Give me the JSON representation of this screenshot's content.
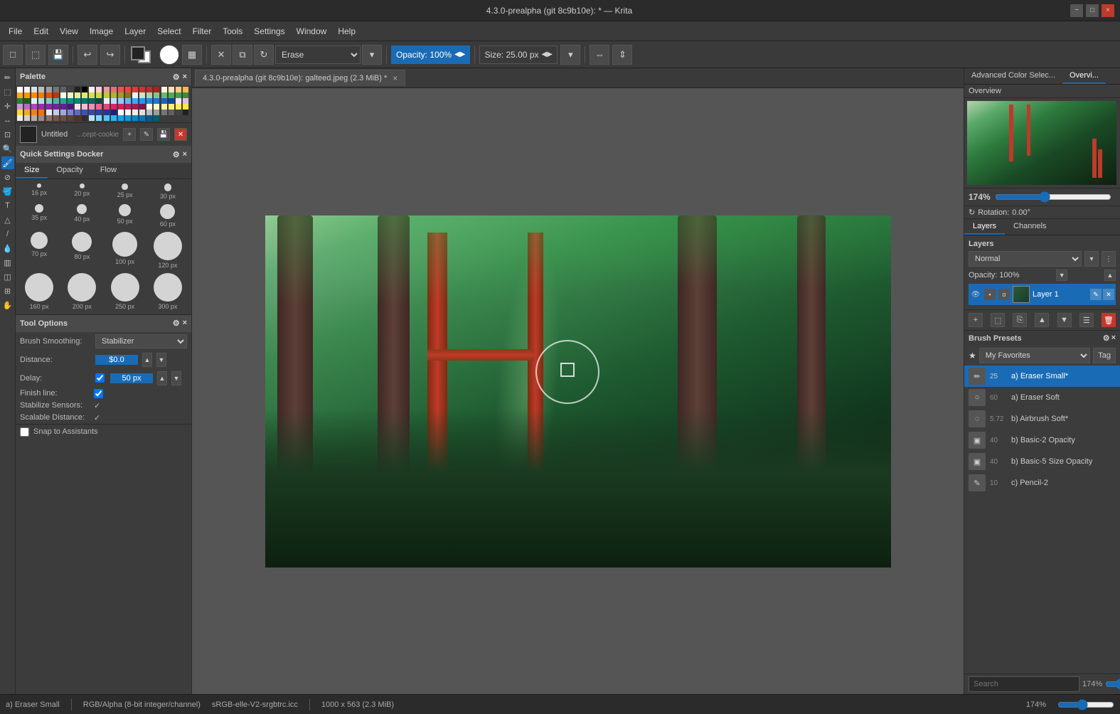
{
  "titlebar": {
    "title": "4.3.0-prealpha (git 8c9b10e): * — Krita",
    "minimize": "−",
    "maximize": "□",
    "close": "×"
  },
  "menubar": {
    "items": [
      "File",
      "Edit",
      "View",
      "Image",
      "Layer",
      "Select",
      "Filter",
      "Tools",
      "Settings",
      "Window",
      "Help"
    ]
  },
  "toolbar": {
    "erase_mode": "Erase",
    "opacity_label": "Opacity: 100%",
    "size_label": "Size: 25.00 px"
  },
  "left_dock": {
    "palette_title": "Palette",
    "color_name": "Untitled",
    "brush_source": "...cept-cookie",
    "quick_settings_title": "Quick Settings Docker",
    "tabs": [
      "Size",
      "Opacity",
      "Flow"
    ],
    "active_tab": "Size",
    "brush_sizes": [
      {
        "size": 16,
        "label": "16 px"
      },
      {
        "size": 20,
        "label": "20 px"
      },
      {
        "size": 25,
        "label": "25 px"
      },
      {
        "size": 30,
        "label": "30 px"
      },
      {
        "size": 35,
        "label": "35 px"
      },
      {
        "size": 40,
        "label": "40 px"
      },
      {
        "size": 50,
        "label": "50 px"
      },
      {
        "size": 60,
        "label": "60 px"
      },
      {
        "size": 70,
        "label": "70 px"
      },
      {
        "size": 80,
        "label": "80 px"
      },
      {
        "size": 100,
        "label": "100 px"
      },
      {
        "size": 120,
        "label": "120 px"
      },
      {
        "size": 160,
        "label": "160 px"
      },
      {
        "size": 200,
        "label": "200 px"
      },
      {
        "size": 250,
        "label": "250 px"
      },
      {
        "size": 300,
        "label": "300 px"
      }
    ],
    "tool_options_title": "Tool Options",
    "brush_smoothing_label": "Brush Smoothing:",
    "brush_smoothing_value": "Stabilizer",
    "distance_label": "Distance:",
    "distance_value": "$0.0",
    "delay_label": "Delay:",
    "delay_value": "50 px",
    "finish_line_label": "Finish line:",
    "stabilize_sensors_label": "Stabilize Sensors:",
    "scalable_distance_label": "Scalable Distance:",
    "snap_to_assistants_label": "Snap to Assistants"
  },
  "canvas": {
    "tab_title": "4.3.0-prealpha (git 8c9b10e): galteed.jpeg (2.3 MiB) *"
  },
  "right_dock": {
    "top_tabs": [
      "Advanced Color Selec...",
      "Overvi..."
    ],
    "active_top_tab": "Overvi...",
    "overview_label": "Overview",
    "zoom_pct": "174%",
    "rotation_label": "Rotation:",
    "rotation_value": "0.00°",
    "layers_channels_tabs": [
      "Layers",
      "Channels"
    ],
    "active_lc_tab": "Layers",
    "layers_label": "Layers",
    "blend_mode": "Normal",
    "opacity_label": "Opacity: 100%",
    "layer1_name": "Layer 1",
    "brush_presets_label": "Brush Presets",
    "tag_label": "Tag",
    "favorites_label": "My Favorites",
    "presets": [
      {
        "num": "25",
        "name": "a) Eraser Small*",
        "active": true
      },
      {
        "num": "60",
        "name": "a) Eraser Soft",
        "active": false
      },
      {
        "num": "5.72",
        "name": "b) Airbrush Soft*",
        "active": false
      },
      {
        "num": "40",
        "name": "b) Basic-2 Opacity",
        "active": false
      },
      {
        "num": "40",
        "name": "b) Basic-5 Size Opacity",
        "active": false
      },
      {
        "num": "10",
        "name": "c) Pencil-2",
        "active": false
      }
    ],
    "search_placeholder": "Search",
    "zoom_right": "174%"
  },
  "statusbar": {
    "brush_name": "a) Eraser Small",
    "color_mode": "RGB/Alpha (8-bit integer/channel)",
    "color_profile": "sRGB-elle-V2-srgbtrc.icc",
    "dimensions": "1000 x 563 (2.3 MiB)",
    "zoom": "174%"
  }
}
